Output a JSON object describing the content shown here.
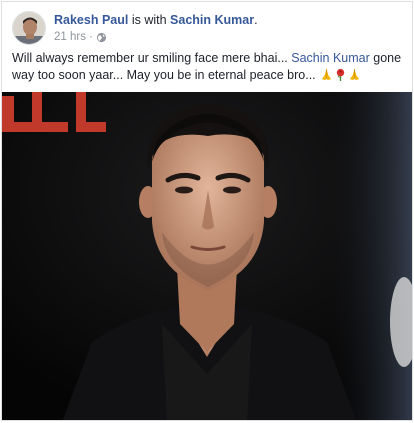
{
  "post": {
    "author": "Rakesh Paul",
    "with_text": "is with",
    "tagged": "Sachin Kumar",
    "period": ".",
    "time": "21 hrs",
    "separator": "·",
    "privacy_icon": "globe-icon",
    "text_before": "Will always remember ur smiling face mere bhai...",
    "mention": "Sachin Kumar",
    "text_after": "gone way too soon yaar... May you be in eternal peace bro...",
    "emojis": [
      "folded-hands-emoji",
      "rose-emoji",
      "folded-hands-emoji"
    ]
  },
  "colors": {
    "link": "#365899",
    "text": "#1d2129",
    "meta": "#90949c",
    "photo_background": "#0a0a0a",
    "sign_red": "#c0392b"
  }
}
